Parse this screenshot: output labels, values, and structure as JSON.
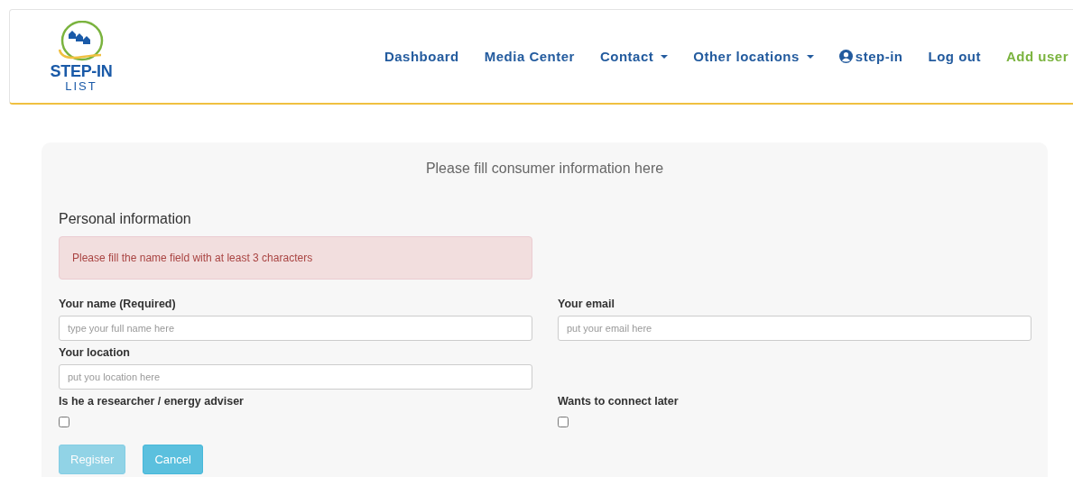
{
  "logo": {
    "title": "STEP-IN",
    "subtitle": "LIST"
  },
  "nav": [
    {
      "label": "Dashboard",
      "kind": "link"
    },
    {
      "label": "Media Center",
      "kind": "link"
    },
    {
      "label": "Contact",
      "kind": "dropdown"
    },
    {
      "label": "Other locations",
      "kind": "dropdown"
    },
    {
      "label": "step-in",
      "kind": "user"
    },
    {
      "label": "Log out",
      "kind": "link"
    },
    {
      "label": "Add user",
      "kind": "accent"
    }
  ],
  "form": {
    "title": "Please fill consumer information here",
    "section": "Personal information",
    "alert": "Please fill the name field with at least 3 characters",
    "rows": [
      [
        {
          "kind": "text",
          "label": "Your name (Required)",
          "placeholder": "type your full name here"
        },
        {
          "kind": "text",
          "label": "Your email",
          "placeholder": "put your email here"
        }
      ],
      [
        {
          "kind": "text",
          "label": "Your location",
          "placeholder": "put you location here"
        }
      ],
      [
        {
          "kind": "checkbox",
          "label": "Is he a researcher / energy adviser",
          "checked": false
        },
        {
          "kind": "checkbox",
          "label": "Wants to connect later",
          "checked": false
        }
      ]
    ],
    "buttons": [
      {
        "label": "Register",
        "disabled": true
      },
      {
        "label": "Cancel",
        "disabled": false
      }
    ]
  }
}
